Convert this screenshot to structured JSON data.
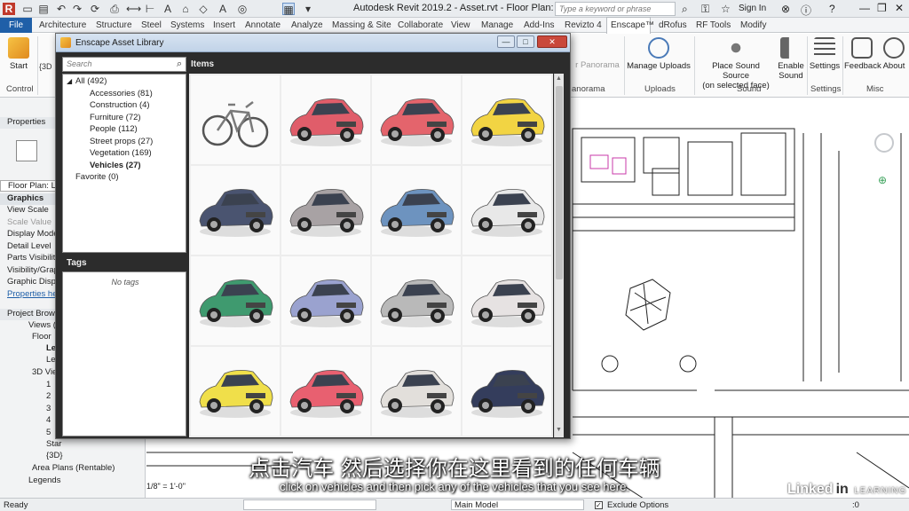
{
  "window": {
    "title": "Autodesk Revit 2019.2 -  Asset.rvt - Floor Plan: Level 1",
    "search_placeholder": "Type a keyword or phrase",
    "sign_in": "Sign In"
  },
  "ribbon": {
    "file_tab": "File",
    "tabs": [
      "Architecture",
      "Structure",
      "Steel",
      "Systems",
      "Insert",
      "Annotate",
      "Analyze",
      "Massing & Site",
      "Collaborate",
      "View",
      "Manage",
      "Add-Ins",
      "Revizto 4",
      "Enscape™",
      "dRofus",
      "RF Tools",
      "Modify"
    ],
    "buttons": {
      "start": "Start",
      "start_group": "Control",
      "panorama": "r Panorama",
      "panorama_group": "anorama",
      "manage_uploads": "Manage Uploads",
      "uploads_group": "Uploads",
      "place_sound": "Place Sound Source",
      "place_sound_2": "(on selected face)",
      "enable_sound": "Enable",
      "enable_sound_2": "Sound",
      "sound_group": "Sound",
      "settings": "Settings",
      "settings_group": "Settings",
      "feedback": "Feedback",
      "about": "About",
      "misc_group": "Misc"
    }
  },
  "left_panel": {
    "view_tab": "{3D",
    "properties_title": "Properties",
    "type_selector": "Floor Plan: Lev",
    "graphics_head": "Graphics",
    "rows": [
      "View Scale",
      "Scale Value",
      "Display Mode",
      "Detail Level",
      "Parts Visibility",
      "Visibility/Grap",
      "Graphic Displ"
    ],
    "properties_help": "Properties hel",
    "browser_title": "Project Brows",
    "tree": [
      "Views (",
      "Floor",
      "Lev",
      "Lev",
      "3D Vie",
      "1",
      "2",
      "3",
      "4",
      "5",
      "Star",
      "{3D}",
      "Area Plans (Rentable)",
      "Legends"
    ]
  },
  "status": {
    "ready": "Ready",
    "scale": "1/8\" = 1'-0\"",
    "model": "Main Model",
    "exclude_options": "Exclude Options",
    "zero": ":0"
  },
  "dialog": {
    "title": "Enscape Asset Library",
    "search_placeholder": "Search",
    "items_header": "Items",
    "tags_header": "Tags",
    "no_tags": "No tags",
    "categories": [
      {
        "label": "All (492)",
        "selected": false
      },
      {
        "label": "Accessories (81)",
        "selected": false
      },
      {
        "label": "Construction (4)",
        "selected": false
      },
      {
        "label": "Furniture (72)",
        "selected": false
      },
      {
        "label": "People (112)",
        "selected": false
      },
      {
        "label": "Street props (27)",
        "selected": false
      },
      {
        "label": "Vegetation (169)",
        "selected": false
      },
      {
        "label": "Vehicles (27)",
        "selected": true
      }
    ],
    "favorite": "Favorite (0)",
    "items": [
      {
        "kind": "bicycle",
        "color": "#7a7a7a"
      },
      {
        "kind": "car",
        "color": "#e05d6a"
      },
      {
        "kind": "car",
        "color": "#e4646c"
      },
      {
        "kind": "car",
        "color": "#f2d443"
      },
      {
        "kind": "car",
        "color": "#4a5470"
      },
      {
        "kind": "car",
        "color": "#a8a2a4"
      },
      {
        "kind": "car",
        "color": "#6d93bf"
      },
      {
        "kind": "car",
        "color": "#e8e8e8"
      },
      {
        "kind": "car",
        "color": "#3f9a6f"
      },
      {
        "kind": "car",
        "color": "#9aa2cf"
      },
      {
        "kind": "car",
        "color": "#b9b9b9"
      },
      {
        "kind": "car",
        "color": "#e6e2e2"
      },
      {
        "kind": "car",
        "color": "#f0df4a"
      },
      {
        "kind": "car",
        "color": "#e86070"
      },
      {
        "kind": "car",
        "color": "#e2dfdb"
      },
      {
        "kind": "car",
        "color": "#343d5c"
      }
    ]
  },
  "subtitles": {
    "cn": "点击汽车 然后选择你在这里看到的任何车辆",
    "en": "click on vehicles and then pick any of the vehicles that you see here."
  },
  "watermark": {
    "brand": "Linked",
    "brand_in": "in",
    "sub": "LEARNING"
  }
}
